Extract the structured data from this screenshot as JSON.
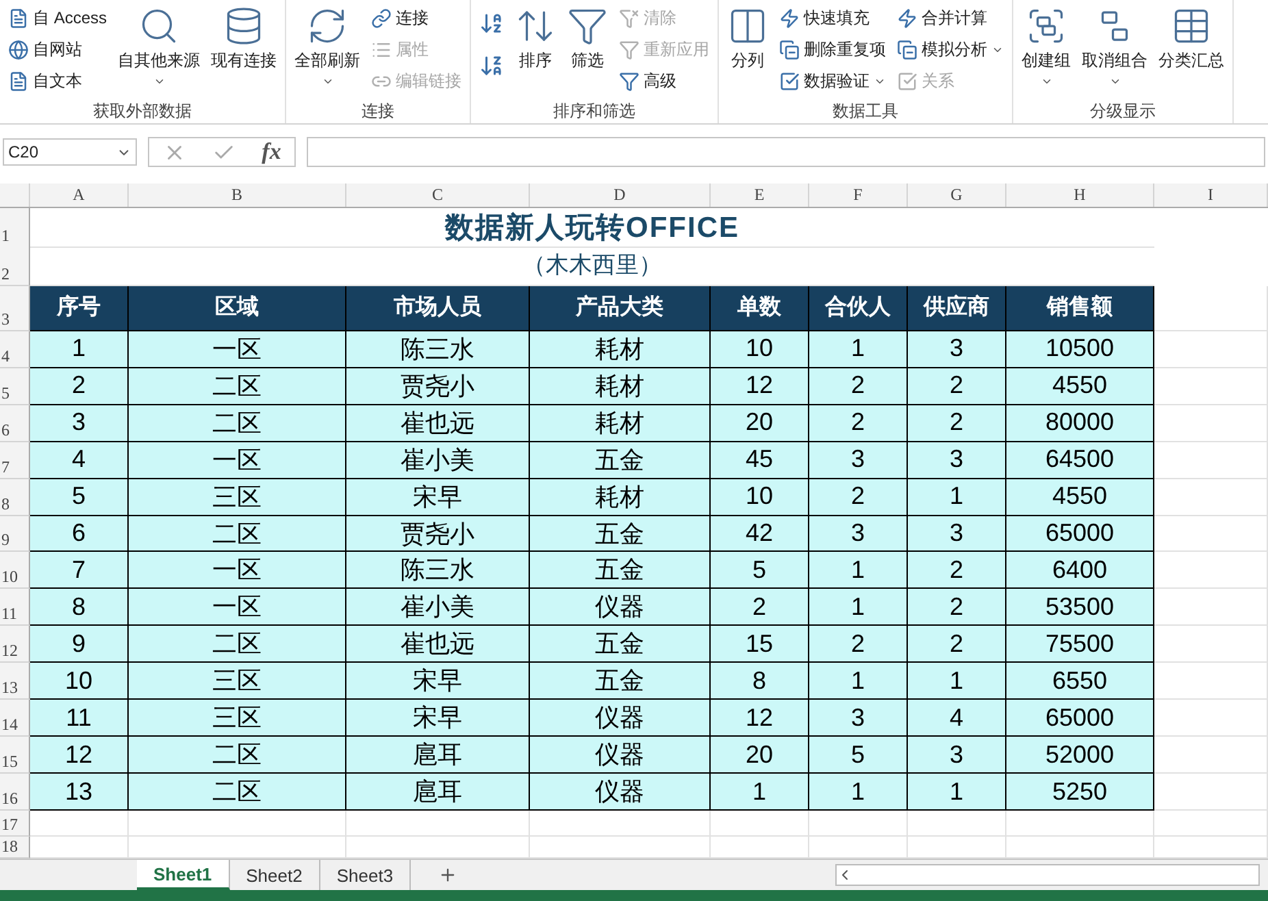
{
  "ribbon": {
    "groups": [
      {
        "label": "获取外部数据",
        "columns": [
          {
            "kind": "stack",
            "items": [
              {
                "label": "自 Access",
                "disabled": false,
                "dropdown": false
              },
              {
                "label": "自网站",
                "disabled": false,
                "dropdown": false
              },
              {
                "label": "自文本",
                "disabled": false,
                "dropdown": false
              }
            ]
          },
          {
            "kind": "large",
            "label": "自其他来源",
            "dropdown": true
          },
          {
            "kind": "large",
            "label": "现有连接",
            "dropdown": false
          }
        ]
      },
      {
        "label": "连接",
        "columns": [
          {
            "kind": "large",
            "label": "全部刷新",
            "dropdown": true
          },
          {
            "kind": "stack",
            "items": [
              {
                "label": "连接",
                "disabled": false,
                "dropdown": false
              },
              {
                "label": "属性",
                "disabled": true,
                "dropdown": false
              },
              {
                "label": "编辑链接",
                "disabled": true,
                "dropdown": false
              }
            ]
          }
        ]
      },
      {
        "label": "排序和筛选",
        "columns": [
          {
            "kind": "sort"
          },
          {
            "kind": "large",
            "label": "排序",
            "dropdown": false
          },
          {
            "kind": "large",
            "label": "筛选",
            "dropdown": false
          },
          {
            "kind": "stack",
            "items": [
              {
                "label": "清除",
                "disabled": true,
                "dropdown": false
              },
              {
                "label": "重新应用",
                "disabled": true,
                "dropdown": false
              },
              {
                "label": "高级",
                "disabled": false,
                "dropdown": false
              }
            ]
          }
        ]
      },
      {
        "label": "数据工具",
        "columns": [
          {
            "kind": "large",
            "label": "分列",
            "dropdown": false
          },
          {
            "kind": "stack",
            "items": [
              {
                "label": "快速填充",
                "disabled": false,
                "dropdown": false
              },
              {
                "label": "删除重复项",
                "disabled": false,
                "dropdown": false
              },
              {
                "label": "数据验证",
                "disabled": false,
                "dropdown": true
              }
            ]
          },
          {
            "kind": "stack",
            "items": [
              {
                "label": "合并计算",
                "disabled": false,
                "dropdown": false
              },
              {
                "label": "模拟分析",
                "disabled": false,
                "dropdown": true
              },
              {
                "label": "关系",
                "disabled": true,
                "dropdown": false
              }
            ]
          }
        ]
      },
      {
        "label": "分级显示",
        "columns": [
          {
            "kind": "large",
            "label": "创建组",
            "dropdown": true
          },
          {
            "kind": "large",
            "label": "取消组合",
            "dropdown": true
          },
          {
            "kind": "large",
            "label": "分类汇总",
            "dropdown": false
          }
        ]
      }
    ]
  },
  "formula_bar": {
    "name_box": "C20",
    "function_label": "fx"
  },
  "sheet": {
    "columns": [
      "A",
      "B",
      "C",
      "D",
      "E",
      "F",
      "G",
      "H",
      "I"
    ],
    "row_numbers": [
      "1",
      "2",
      "3",
      "4",
      "5",
      "6",
      "7",
      "8",
      "9",
      "10",
      "11",
      "12",
      "13",
      "14",
      "15",
      "16",
      "17",
      "18"
    ],
    "title": "数据新人玩转OFFICE",
    "subtitle": "（木木西里）",
    "headers": [
      "序号",
      "区域",
      "市场人员",
      "产品大类",
      "单数",
      "合伙人",
      "供应商",
      "销售额"
    ],
    "rows": [
      [
        "1",
        "一区",
        "陈三水",
        "耗材",
        "10",
        "1",
        "3",
        "10500"
      ],
      [
        "2",
        "二区",
        "贾尧小",
        "耗材",
        "12",
        "2",
        "2",
        "4550"
      ],
      [
        "3",
        "二区",
        "崔也远",
        "耗材",
        "20",
        "2",
        "2",
        "80000"
      ],
      [
        "4",
        "一区",
        "崔小美",
        "五金",
        "45",
        "3",
        "3",
        "64500"
      ],
      [
        "5",
        "三区",
        "宋早",
        "耗材",
        "10",
        "2",
        "1",
        "4550"
      ],
      [
        "6",
        "二区",
        "贾尧小",
        "五金",
        "42",
        "3",
        "3",
        "65000"
      ],
      [
        "7",
        "一区",
        "陈三水",
        "五金",
        "5",
        "1",
        "2",
        "6400"
      ],
      [
        "8",
        "一区",
        "崔小美",
        "仪器",
        "2",
        "1",
        "2",
        "53500"
      ],
      [
        "9",
        "二区",
        "崔也远",
        "五金",
        "15",
        "2",
        "2",
        "75500"
      ],
      [
        "10",
        "三区",
        "宋早",
        "五金",
        "8",
        "1",
        "1",
        "6550"
      ],
      [
        "11",
        "三区",
        "宋早",
        "仪器",
        "12",
        "3",
        "4",
        "65000"
      ],
      [
        "12",
        "二区",
        "扈耳",
        "仪器",
        "20",
        "5",
        "3",
        "52000"
      ],
      [
        "13",
        "二区",
        "扈耳",
        "仪器",
        "1",
        "1",
        "1",
        "5250"
      ]
    ]
  },
  "sheet_tabs": [
    {
      "label": "Sheet1",
      "selected": true
    },
    {
      "label": "Sheet2",
      "selected": false
    },
    {
      "label": "Sheet3",
      "selected": false
    }
  ]
}
